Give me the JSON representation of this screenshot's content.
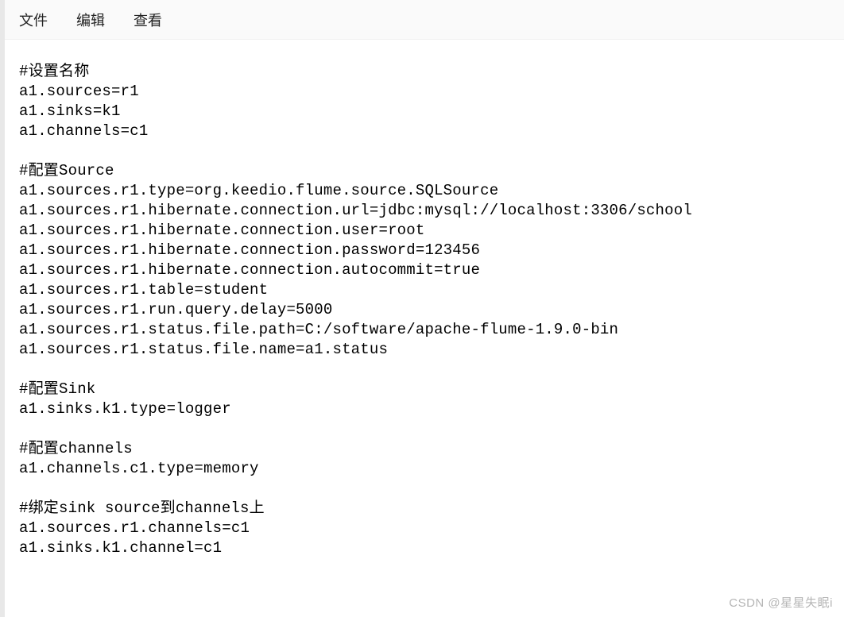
{
  "menubar": {
    "file": "文件",
    "edit": "编辑",
    "view": "查看"
  },
  "content": {
    "lines": [
      "#设置名称",
      "a1.sources=r1",
      "a1.sinks=k1",
      "a1.channels=c1",
      "",
      "#配置Source",
      "a1.sources.r1.type=org.keedio.flume.source.SQLSource",
      "a1.sources.r1.hibernate.connection.url=jdbc:mysql://localhost:3306/school",
      "a1.sources.r1.hibernate.connection.user=root",
      "a1.sources.r1.hibernate.connection.password=123456",
      "a1.sources.r1.hibernate.connection.autocommit=true",
      "a1.sources.r1.table=student",
      "a1.sources.r1.run.query.delay=5000",
      "a1.sources.r1.status.file.path=C:/software/apache-flume-1.9.0-bin",
      "a1.sources.r1.status.file.name=a1.status",
      "",
      "#配置Sink",
      "a1.sinks.k1.type=logger",
      "",
      "#配置channels",
      "a1.channels.c1.type=memory",
      "",
      "#绑定sink source到channels上",
      "a1.sources.r1.channels=c1",
      "a1.sinks.k1.channel=c1"
    ]
  },
  "watermark": "CSDN @星星失眠i"
}
